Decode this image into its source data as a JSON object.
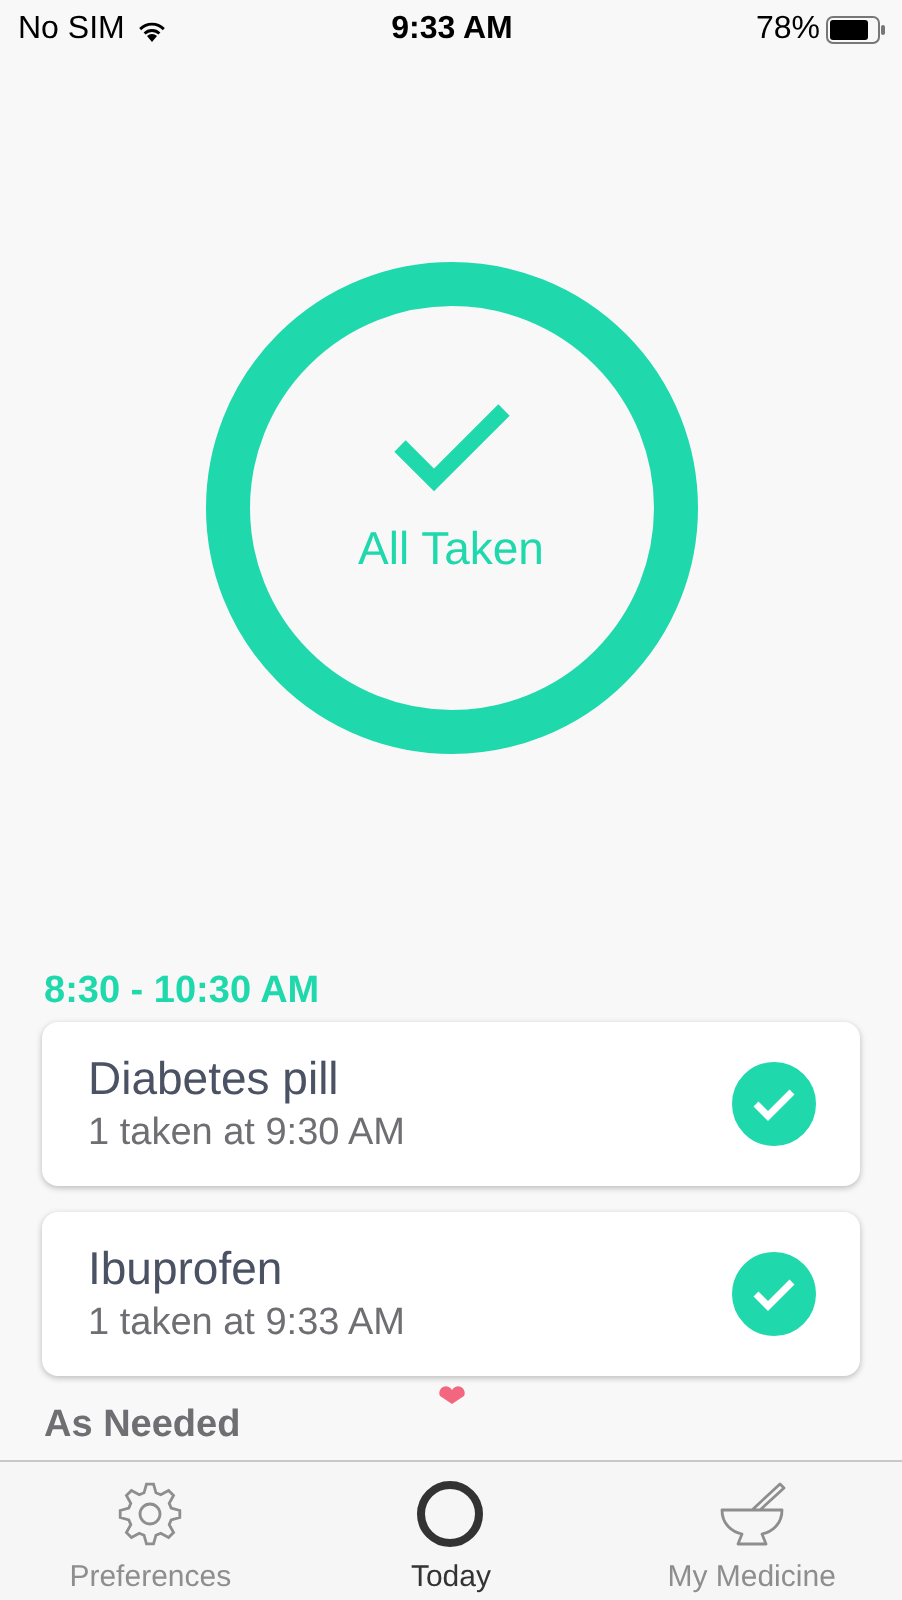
{
  "status_bar": {
    "carrier": "No SIM",
    "time": "9:33 AM",
    "battery": "78%"
  },
  "summary": {
    "label": "All Taken",
    "level": 1
  },
  "sections": [
    {
      "title": "8:30 - 10:30 AM",
      "doses": [
        {
          "name": "Diabetes pill",
          "detail": "1 taken at 9:30 AM",
          "taken": true
        },
        {
          "name": "Ibuprofen",
          "detail": "1 taken at 9:33 AM",
          "taken": true
        }
      ]
    }
  ],
  "as_needed": {
    "title": "As Needed"
  },
  "tab_bar": [
    {
      "label": "Preferences",
      "kind": "gear",
      "selected": false
    },
    {
      "label": "Today",
      "kind": "ring",
      "selected": true
    },
    {
      "label": "My Medicine",
      "kind": "mortar",
      "selected": false
    }
  ]
}
